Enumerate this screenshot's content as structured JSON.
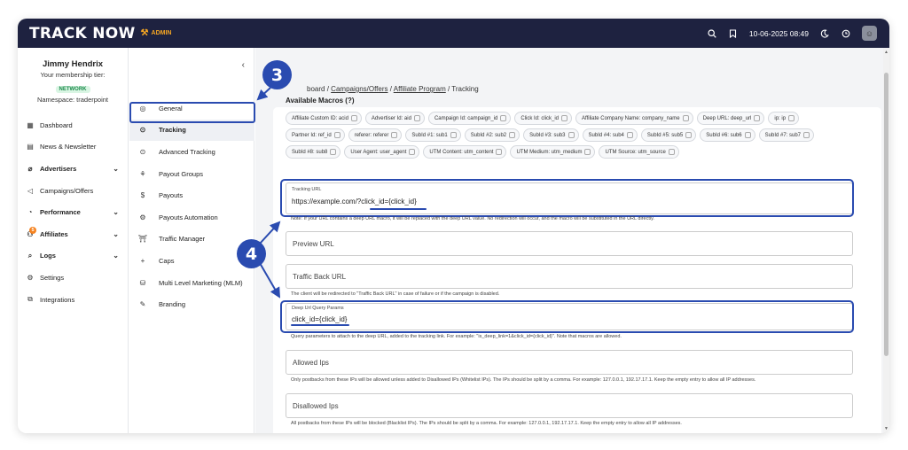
{
  "header": {
    "logo": "TRACK NOW",
    "admin_label": "ADMIN",
    "datetime": "10-06-2025 08:49"
  },
  "user": {
    "name": "Jimmy Hendrix",
    "tier_label": "Your membership tier:",
    "tier": "NETWORK",
    "namespace": "Namespace: traderpoint"
  },
  "sidebar": {
    "items": [
      {
        "label": "Dashboard",
        "icon": "dashboard-icon"
      },
      {
        "label": "News & Newsletter",
        "icon": "news-icon"
      },
      {
        "label": "Advertisers",
        "icon": "advertisers-icon"
      },
      {
        "label": "Campaigns/Offers",
        "icon": "campaigns-icon"
      },
      {
        "label": "Performance",
        "icon": "performance-icon"
      },
      {
        "label": "Affiliates",
        "icon": "affiliates-icon",
        "badge": "5"
      },
      {
        "label": "Logs",
        "icon": "logs-icon"
      },
      {
        "label": "Settings",
        "icon": "settings-icon"
      },
      {
        "label": "Integrations",
        "icon": "integrations-icon"
      }
    ]
  },
  "subnav": {
    "items": [
      {
        "label": "General"
      },
      {
        "label": "Tracking"
      },
      {
        "label": "Advanced Tracking"
      },
      {
        "label": "Payout Groups"
      },
      {
        "label": "Payouts"
      },
      {
        "label": "Payouts Automation"
      },
      {
        "label": "Traffic Manager"
      },
      {
        "label": "Caps"
      },
      {
        "label": "Multi Level Marketing (MLM)"
      },
      {
        "label": "Branding"
      }
    ]
  },
  "breadcrumb": {
    "first": "board",
    "second": "Campaigns/Offers",
    "third": "Affiliate Program",
    "current": "Tracking",
    "sep": "/"
  },
  "macros": {
    "title": "Available Macros (?)",
    "chips": [
      "Affiliate Custom ID: acid",
      "Advertiser Id: aid",
      "Campaign Id: campaign_id",
      "Click Id: click_id",
      "Affiliate Company Name: company_name",
      "Deep URL: deep_url",
      "ip: ip",
      "Partner Id: ref_id",
      "referer: referer",
      "SubId #1: sub1",
      "SubId #2: sub2",
      "SubId #3: sub3",
      "SubId #4: sub4",
      "SubId #5: sub5",
      "SubId #6: sub6",
      "SubId #7: sub7",
      "SubId #8: sub8",
      "User Agent: user_agent",
      "UTM Content: utm_content",
      "UTM Medium: utm_medium",
      "UTM Source: utm_source"
    ]
  },
  "fields": {
    "tracking_url_label": "Tracking URL",
    "tracking_url_value": "https://example.com/?click_id={click_id}",
    "tracking_url_note": "Note: If your URL contains a deep URL macro, it will be replaced with the deep URL value. No redirection will occur, and the macro will be substituted in the URL directly.",
    "preview_url": "Preview URL",
    "traffic_back_url": "Traffic Back URL",
    "traffic_back_note": "The client will be redirected to \"Traffic Back URL\" in case of failure or if the campaign is disabled.",
    "deep_url_label": "Deep Url Query Params",
    "deep_url_value": "click_id={click_id}",
    "deep_url_note": "Query parameters to attach to the deep URL, added to the tracking link. For example: \"is_deep_link=1&click_id={click_id}\". Note that macros are allowed.",
    "allowed_ips": "Allowed Ips",
    "allowed_ips_note": "Only postbacks from these IPs will be allowed unless added to Disallowed IPs (Whitelist IPs). The IPs should be split by a comma. For example: 127.0.0.1, 192.17.17.1. Keep the empty entry to allow all IP addresses.",
    "disallowed_ips": "Disallowed Ips",
    "disallowed_ips_note": "All postbacks from these IPs will be blocked (Blacklist IPs). The IPs should be split by a comma. For example: 127.0.0.1, 192.17.17.1. Keep the empty entry to allow all IP addresses."
  },
  "annotations": {
    "step3": "3",
    "step4": "4",
    "accent": "#2a4bb0"
  }
}
